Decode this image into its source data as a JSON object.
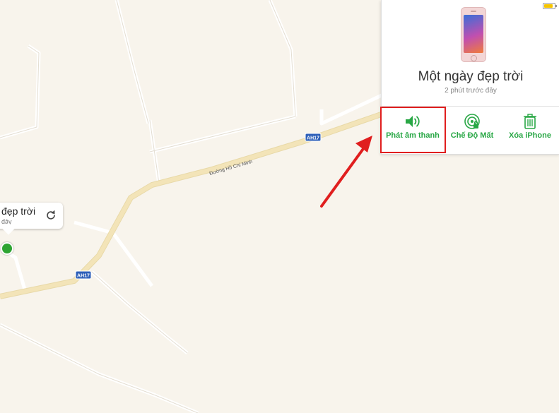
{
  "map": {
    "road_label": "Đường Hồ Chí Minh",
    "highway_shields": [
      "AH17",
      "AH17"
    ]
  },
  "pin": {
    "title": "đẹp trời",
    "subtitle": "đây"
  },
  "device": {
    "name": "Một ngày đẹp trời",
    "last_seen": "2 phút trước đây"
  },
  "actions": {
    "play_sound": "Phát âm thanh",
    "lost_mode": "Chế Độ Mất",
    "erase": "Xóa iPhone"
  },
  "colors": {
    "accent": "#28a745",
    "highlight": "#e01e1e",
    "map_bg": "#f8f4ec",
    "road": "#f3e4b8"
  }
}
